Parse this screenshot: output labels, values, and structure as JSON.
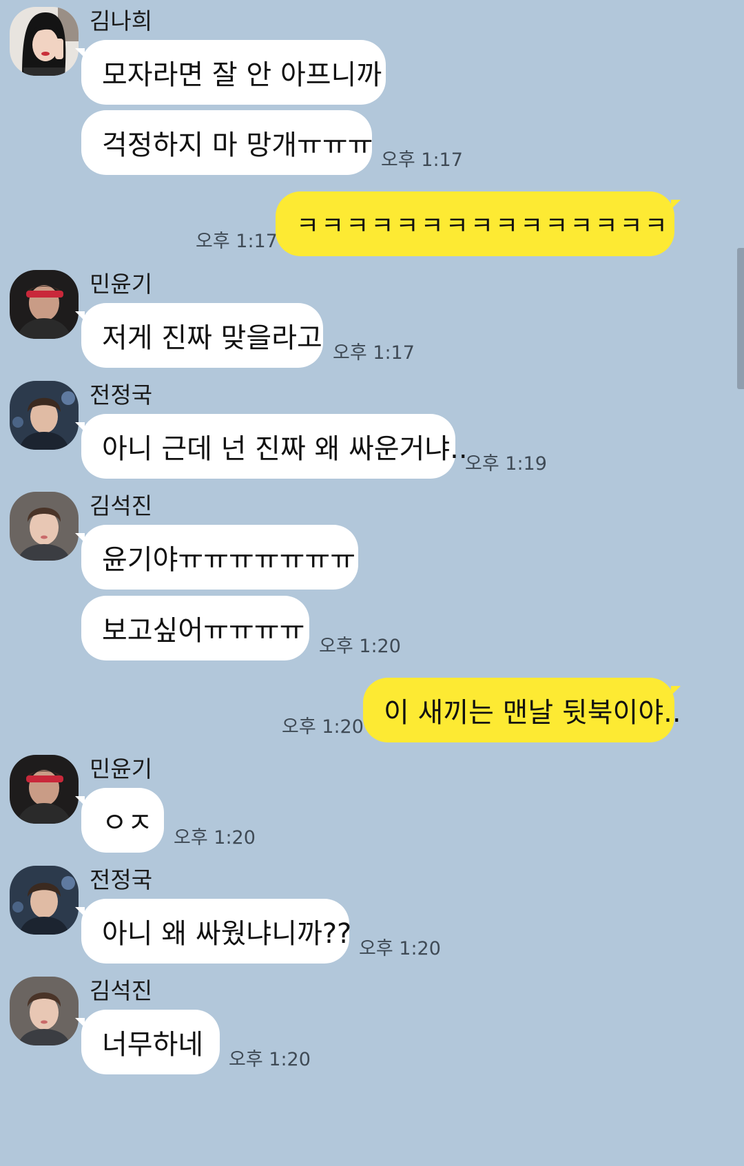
{
  "messages": [
    {
      "sender": "김나희",
      "bubbles": [
        "모자라면 잘 안 아프니까",
        "걱정하지 마 망개ㅠㅠㅠ"
      ],
      "time": "오후 1:17",
      "avatar": "kimnahee-avatar"
    },
    {
      "me": true,
      "bubbles": [
        "ㅋㅋㅋㅋㅋㅋㅋㅋㅋㅋㅋㅋㅋㅋㅋ"
      ],
      "time": "오후 1:17"
    },
    {
      "sender": "민윤기",
      "bubbles": [
        "저게 진짜 맞을라고"
      ],
      "time": "오후 1:17",
      "avatar": "minyoongi-avatar"
    },
    {
      "sender": "전정국",
      "bubbles": [
        "아니 근데 넌 진짜 왜 싸운거냐.."
      ],
      "time": "오후 1:19",
      "avatar": "jeonjungkook-avatar"
    },
    {
      "sender": "김석진",
      "bubbles": [
        "윤기야ㅠㅠㅠㅠㅠㅠㅠ",
        "보고싶어ㅠㅠㅠㅠ"
      ],
      "time": "오후 1:20",
      "avatar": "kimseokjin-avatar"
    },
    {
      "me": true,
      "bubbles": [
        "이 새끼는 맨날 뒷북이야.."
      ],
      "time": "오후 1:20"
    },
    {
      "sender": "민윤기",
      "bubbles": [
        "ㅇㅈ"
      ],
      "time": "오후 1:20",
      "avatar": "minyoongi-avatar"
    },
    {
      "sender": "전정국",
      "bubbles": [
        "아니 왜 싸웠냐니까??"
      ],
      "time": "오후 1:20",
      "avatar": "jeonjungkook-avatar"
    },
    {
      "sender": "김석진",
      "bubbles": [
        "너무하네"
      ],
      "time": "오후 1:20",
      "avatar": "kimseokjin-avatar"
    }
  ],
  "colors": {
    "background": "#b2c7da",
    "my_bubble": "#fdea33",
    "other_bubble": "#ffffff"
  }
}
